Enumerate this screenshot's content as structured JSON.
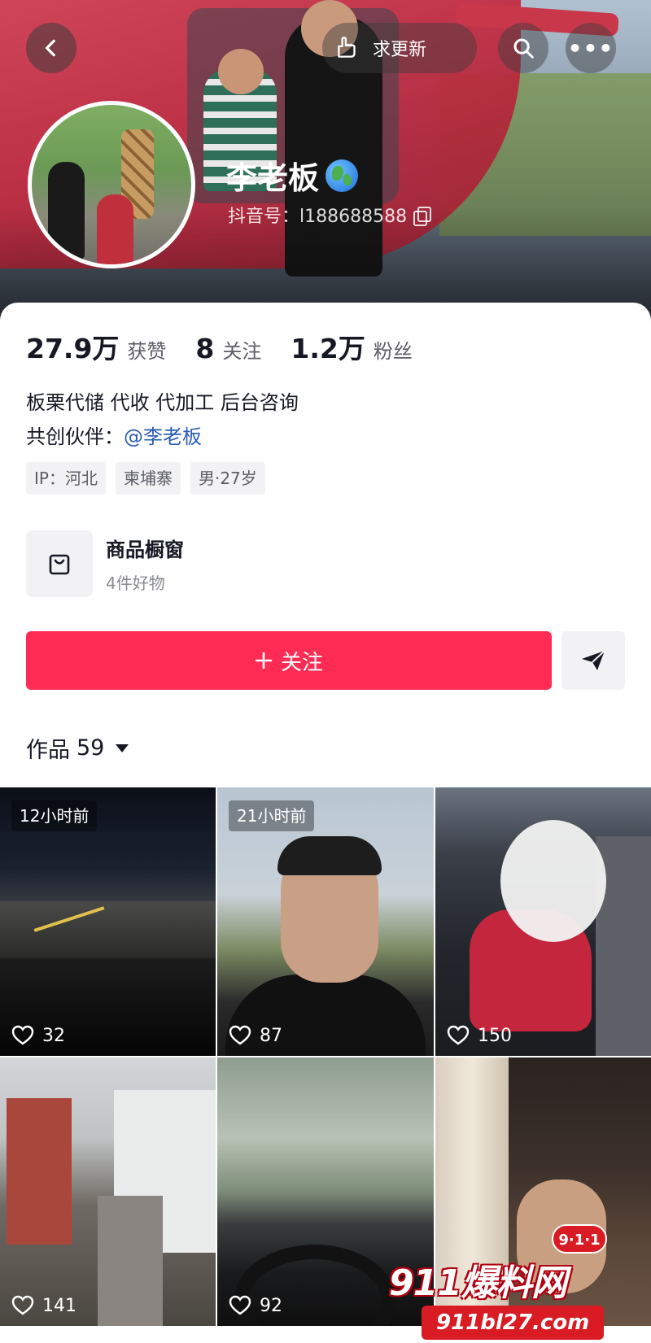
{
  "header": {
    "update_label": "求更新",
    "nickname": "李老板",
    "douyin_id": "抖音号：l188688588"
  },
  "stats": [
    {
      "value": "27.9万",
      "label": "获赞"
    },
    {
      "value": "8",
      "label": "关注"
    },
    {
      "value": "1.2万",
      "label": "粉丝"
    }
  ],
  "bio": {
    "line1": "板栗代储 代收 代加工 后台咨询",
    "partner_prefix": "共创伙伴：",
    "partner_mention": "@李老板"
  },
  "tags": [
    "IP：河北",
    "柬埔寨",
    "男·27岁"
  ],
  "shop": {
    "title": "商品橱窗",
    "subtitle": "4件好物"
  },
  "actions": {
    "follow_label": "关注"
  },
  "works": {
    "label": "作品",
    "count": "59"
  },
  "grid": [
    {
      "time": "12小时前",
      "likes": "32"
    },
    {
      "time": "21小时前",
      "likes": "87"
    },
    {
      "time": "",
      "likes": "150"
    },
    {
      "time": "",
      "likes": "141"
    },
    {
      "time": "",
      "likes": "92"
    },
    {
      "time": "",
      "likes": ""
    }
  ],
  "watermark": {
    "badge": "9·1·1",
    "brand": "911爆料网",
    "url": "911bl27.com"
  },
  "colors": {
    "accent": "#fe2c55",
    "mention": "#2b5db4"
  }
}
